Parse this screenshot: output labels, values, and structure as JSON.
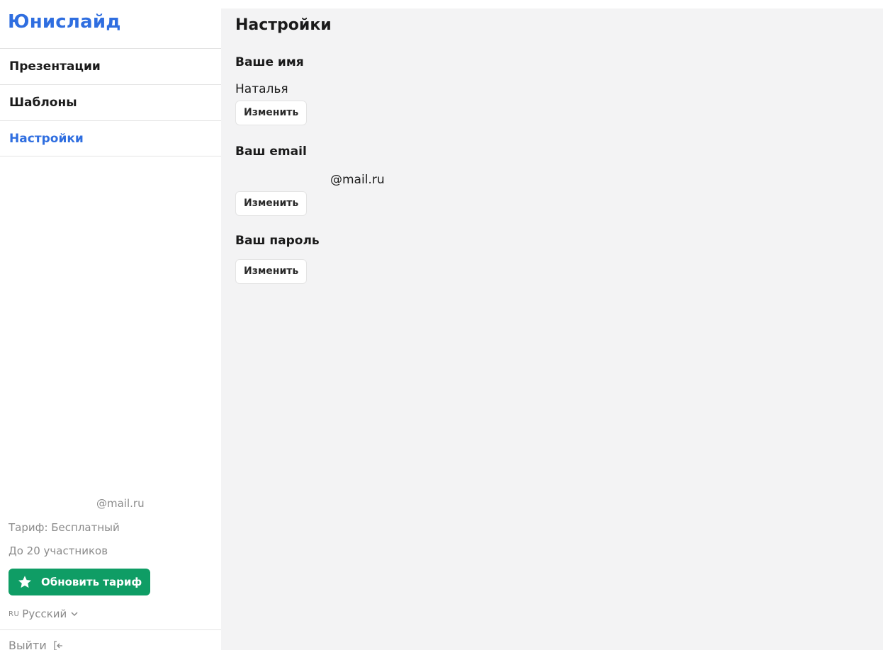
{
  "app": {
    "logo": "Юнислайд"
  },
  "sidebar": {
    "items": [
      {
        "label": "Презентации",
        "active": false
      },
      {
        "label": "Шаблоны",
        "active": false
      },
      {
        "label": "Настройки",
        "active": true
      }
    ],
    "account": {
      "email_domain": "@mail.ru",
      "plan": "Тариф: Бесплатный",
      "limit": "До 20 участников",
      "upgrade_label": "Обновить тариф",
      "upgrade_icon": "star-icon",
      "lang_code": "RU",
      "lang_label": "Русский",
      "logout_label": "Выйти",
      "logout_icon": "logout-icon"
    }
  },
  "main": {
    "title": "Настройки",
    "name_section": {
      "title": "Ваше имя",
      "value": "Наталья",
      "button": "Изменить"
    },
    "email_section": {
      "title": "Ваш email",
      "domain": "@mail.ru",
      "button": "Изменить"
    },
    "password_section": {
      "title": "Ваш пароль",
      "button": "Изменить"
    }
  },
  "colors": {
    "accent": "#2f6ee0",
    "upgrade": "#0f9d65",
    "main_bg": "#f3f3f4",
    "muted_text": "#8a8a8a"
  }
}
